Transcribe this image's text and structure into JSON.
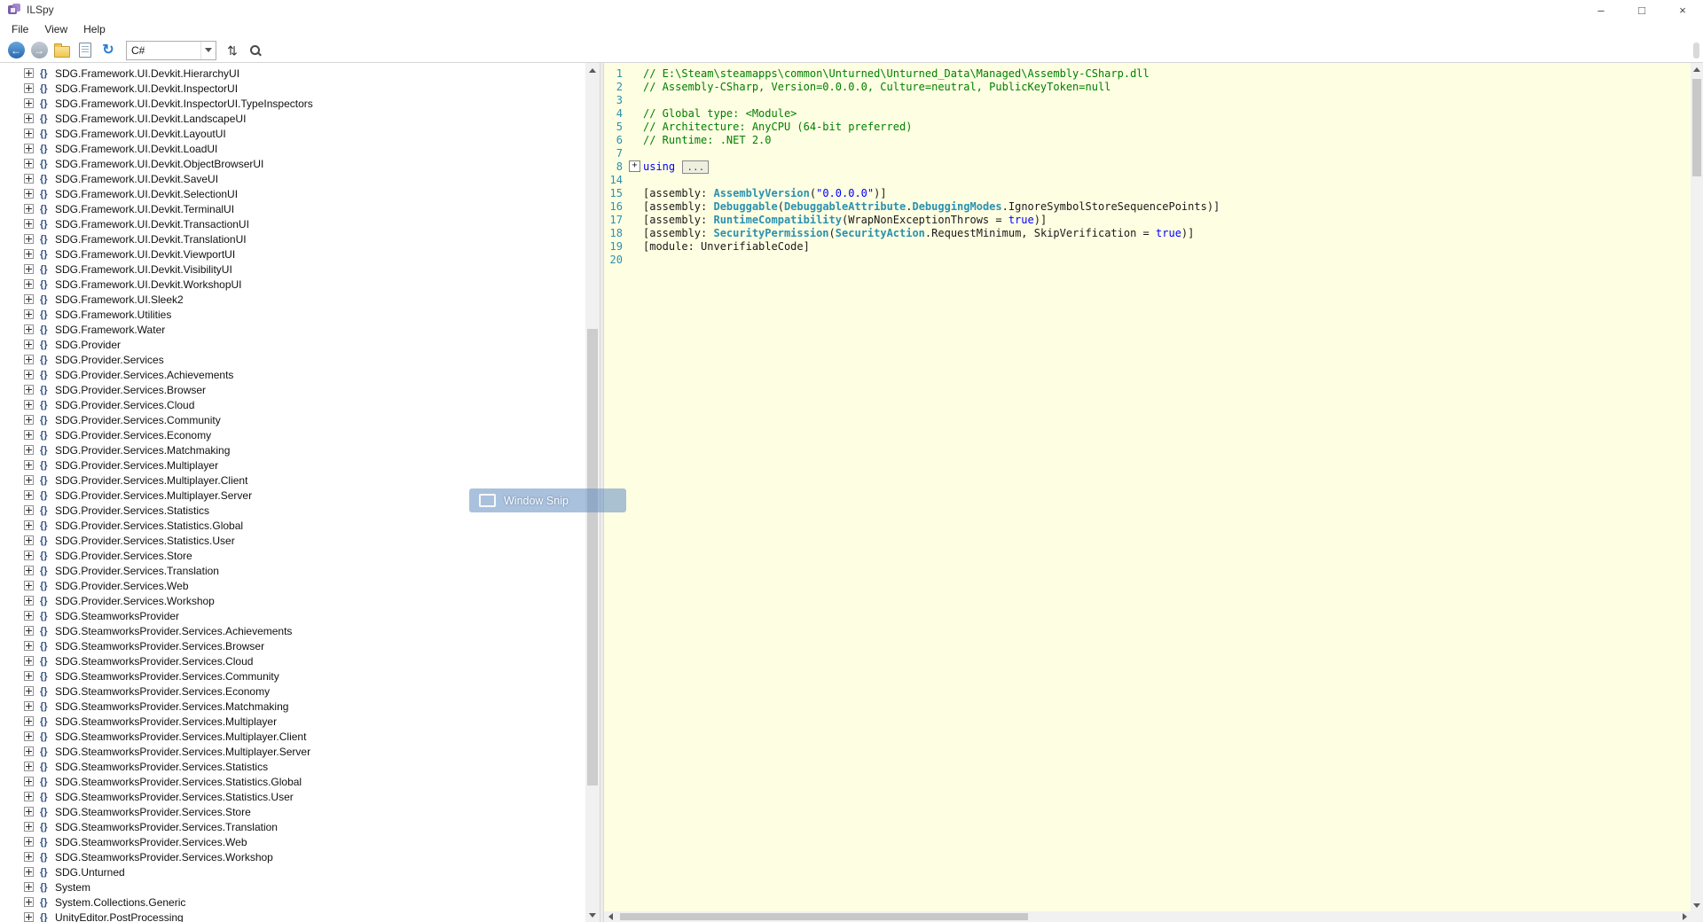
{
  "window": {
    "title": "ILSpy",
    "controls": {
      "minimize": "–",
      "maximize": "□",
      "close": "×"
    }
  },
  "menu": {
    "items": [
      "File",
      "View",
      "Help"
    ]
  },
  "toolbar": {
    "language": "C#",
    "left_buttons": [
      {
        "name": "back-button",
        "icon": "back-icon",
        "kind": "back",
        "glyph": "←"
      },
      {
        "name": "forward-button",
        "icon": "forward-icon",
        "kind": "forward",
        "glyph": "→"
      },
      {
        "name": "open-file-button",
        "icon": "open-folder-icon",
        "kind": "open",
        "glyph": ""
      },
      {
        "name": "open-assembly-list-button",
        "icon": "assembly-list-icon",
        "kind": "list",
        "glyph": ""
      },
      {
        "name": "reload-button",
        "icon": "reload-icon",
        "kind": "reload",
        "glyph": "↻"
      }
    ],
    "right_buttons": [
      {
        "name": "sort-assemblies-button",
        "icon": "sort-icon",
        "kind": "sort",
        "glyph": "⇅"
      },
      {
        "name": "search-button",
        "icon": "search-icon",
        "kind": "search",
        "glyph": ""
      }
    ]
  },
  "tree": {
    "namespace_glyph": "{}",
    "items": [
      "SDG.Framework.UI.Devkit.HierarchyUI",
      "SDG.Framework.UI.Devkit.InspectorUI",
      "SDG.Framework.UI.Devkit.InspectorUI.TypeInspectors",
      "SDG.Framework.UI.Devkit.LandscapeUI",
      "SDG.Framework.UI.Devkit.LayoutUI",
      "SDG.Framework.UI.Devkit.LoadUI",
      "SDG.Framework.UI.Devkit.ObjectBrowserUI",
      "SDG.Framework.UI.Devkit.SaveUI",
      "SDG.Framework.UI.Devkit.SelectionUI",
      "SDG.Framework.UI.Devkit.TerminalUI",
      "SDG.Framework.UI.Devkit.TransactionUI",
      "SDG.Framework.UI.Devkit.TranslationUI",
      "SDG.Framework.UI.Devkit.ViewportUI",
      "SDG.Framework.UI.Devkit.VisibilityUI",
      "SDG.Framework.UI.Devkit.WorkshopUI",
      "SDG.Framework.UI.Sleek2",
      "SDG.Framework.Utilities",
      "SDG.Framework.Water",
      "SDG.Provider",
      "SDG.Provider.Services",
      "SDG.Provider.Services.Achievements",
      "SDG.Provider.Services.Browser",
      "SDG.Provider.Services.Cloud",
      "SDG.Provider.Services.Community",
      "SDG.Provider.Services.Economy",
      "SDG.Provider.Services.Matchmaking",
      "SDG.Provider.Services.Multiplayer",
      "SDG.Provider.Services.Multiplayer.Client",
      "SDG.Provider.Services.Multiplayer.Server",
      "SDG.Provider.Services.Statistics",
      "SDG.Provider.Services.Statistics.Global",
      "SDG.Provider.Services.Statistics.User",
      "SDG.Provider.Services.Store",
      "SDG.Provider.Services.Translation",
      "SDG.Provider.Services.Web",
      "SDG.Provider.Services.Workshop",
      "SDG.SteamworksProvider",
      "SDG.SteamworksProvider.Services.Achievements",
      "SDG.SteamworksProvider.Services.Browser",
      "SDG.SteamworksProvider.Services.Cloud",
      "SDG.SteamworksProvider.Services.Community",
      "SDG.SteamworksProvider.Services.Economy",
      "SDG.SteamworksProvider.Services.Matchmaking",
      "SDG.SteamworksProvider.Services.Multiplayer",
      "SDG.SteamworksProvider.Services.Multiplayer.Client",
      "SDG.SteamworksProvider.Services.Multiplayer.Server",
      "SDG.SteamworksProvider.Services.Statistics",
      "SDG.SteamworksProvider.Services.Statistics.Global",
      "SDG.SteamworksProvider.Services.Statistics.User",
      "SDG.SteamworksProvider.Services.Store",
      "SDG.SteamworksProvider.Services.Translation",
      "SDG.SteamworksProvider.Services.Web",
      "SDG.SteamworksProvider.Services.Workshop",
      "SDG.Unturned",
      "System",
      "System.Collections.Generic",
      "UnityEditor.PostProcessing"
    ]
  },
  "editor": {
    "background": "#FEFEE2",
    "colors": {
      "comment": "#008000",
      "keyword": "#0000FF",
      "type": "#2B91AF",
      "string": "#0000FF",
      "line_number": "#2B91AF"
    },
    "lines": [
      {
        "n": "1",
        "segs": [
          {
            "c": "com",
            "t": "// E:\\Steam\\steamapps\\common\\Unturned\\Unturned_Data\\Managed\\Assembly-CSharp.dll"
          }
        ]
      },
      {
        "n": "2",
        "segs": [
          {
            "c": "com",
            "t": "// Assembly-CSharp, Version=0.0.0.0, Culture=neutral, PublicKeyToken=null"
          }
        ]
      },
      {
        "n": "3",
        "segs": []
      },
      {
        "n": "4",
        "segs": [
          {
            "c": "com",
            "t": "// Global type: <Module>"
          }
        ]
      },
      {
        "n": "5",
        "segs": [
          {
            "c": "com",
            "t": "// Architecture: AnyCPU (64-bit preferred)"
          }
        ]
      },
      {
        "n": "6",
        "segs": [
          {
            "c": "com",
            "t": "// Runtime: .NET 2.0"
          }
        ]
      },
      {
        "n": "7",
        "segs": []
      },
      {
        "n": "8",
        "fold": "+",
        "segs": [
          {
            "c": "kw",
            "t": "using "
          },
          {
            "c": "ell",
            "t": "..."
          }
        ]
      },
      {
        "n": "14",
        "segs": []
      },
      {
        "n": "15",
        "segs": [
          {
            "c": "pl",
            "t": "[assembly: "
          },
          {
            "c": "ty",
            "t": "AssemblyVersion"
          },
          {
            "c": "pl",
            "t": "("
          },
          {
            "c": "str",
            "t": "\"0.0.0.0\""
          },
          {
            "c": "pl",
            "t": ")]"
          }
        ]
      },
      {
        "n": "16",
        "segs": [
          {
            "c": "pl",
            "t": "[assembly: "
          },
          {
            "c": "ty",
            "t": "Debuggable"
          },
          {
            "c": "pl",
            "t": "("
          },
          {
            "c": "ty",
            "t": "DebuggableAttribute"
          },
          {
            "c": "pl",
            "t": "."
          },
          {
            "c": "ty",
            "t": "DebuggingModes"
          },
          {
            "c": "pl",
            "t": ".IgnoreSymbolStoreSequencePoints)]"
          }
        ]
      },
      {
        "n": "17",
        "segs": [
          {
            "c": "pl",
            "t": "[assembly: "
          },
          {
            "c": "ty",
            "t": "RuntimeCompatibility"
          },
          {
            "c": "pl",
            "t": "(WrapNonExceptionThrows = "
          },
          {
            "c": "kw",
            "t": "true"
          },
          {
            "c": "pl",
            "t": ")]"
          }
        ]
      },
      {
        "n": "18",
        "segs": [
          {
            "c": "pl",
            "t": "[assembly: "
          },
          {
            "c": "ty",
            "t": "SecurityPermission"
          },
          {
            "c": "pl",
            "t": "("
          },
          {
            "c": "ty",
            "t": "SecurityAction"
          },
          {
            "c": "pl",
            "t": ".RequestMinimum, SkipVerification = "
          },
          {
            "c": "kw",
            "t": "true"
          },
          {
            "c": "pl",
            "t": ")]"
          }
        ]
      },
      {
        "n": "19",
        "segs": [
          {
            "c": "pl",
            "t": "[module: UnverifiableCode]"
          }
        ]
      },
      {
        "n": "20",
        "segs": []
      }
    ]
  },
  "overlay": {
    "label": "Window Snip"
  }
}
